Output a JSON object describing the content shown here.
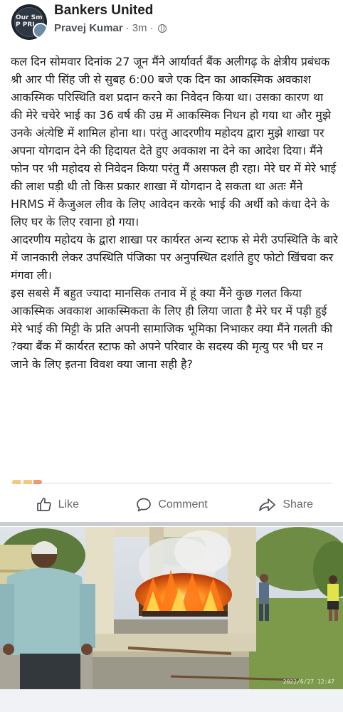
{
  "post": {
    "group_name": "Bankers United",
    "author": "Pravej Kumar",
    "time": "3m",
    "separator": "·",
    "privacy_icon": "globe-icon",
    "avatar_text": "Our Sm P PRI",
    "paragraphs": [
      "कल दिन सोमवार दिनांक 27 जून मैंने आर्यावर्त बैंक  अलीगढ़ के क्षेत्रीय प्रबंधक श्री आर पी सिंह जी से सुबह 6:00 बजे एक दिन का आकस्मिक अवकाश आकस्मिक परिस्थिति वश प्रदान करने का निवेदन किया था। उसका कारण था की मेरे चचेरे भाई का 36 वर्ष की उम्र में आकस्मिक निधन हो गया था और मुझे उनके अंत्येष्टि में शामिल होना था। परंतु आदरणीय महोदय द्वारा मुझे शाखा पर अपना योगदान देने की हिदायत देते हुए अवकाश ना देने का आदेश दिया। मैंने फोन पर भी महोदय से निवेदन किया परंतु मैं असफल ही रहा। मेरे घर में मेरे भाई की लाश पड़ी थी तो किस प्रकार शाखा में योगदान दे सकता था अतः मैंने HRMS में कैजुअल लीव के लिए आवेदन करके भाई की अर्थी को कंधा देने के लिए घर के लिए रवाना हो गया।",
      "आदरणीय महोदय के द्वारा शाखा पर कार्यरत अन्य स्टाफ से मेरी उपस्थिति के बारे में जानकारी लेकर उपस्थिति पंजिका पर अनुपस्थित दर्शाते हुए फोटो खिंचवा कर मंगवा ली।",
      "इस सबसे मैं बहुत ज्यादा मानसिक तनाव में हूं क्या मैंने कुछ गलत किया आकस्मिक अवकाश आकस्मिकता के लिए ही लिया जाता है मेरे घर में पड़ी हुई मेरे भाई की मिट्टी के प्रति अपनी सामाजिक भूमिका निभाकर क्या मैंने गलती की ?क्या बैंक में कार्यरत स्टाफ को अपने परिवार के सदस्य  की मृत्यु पर भी घर न जाने के लिए इतना विवश क्या जाना सही है?"
    ]
  },
  "actions": {
    "like": "Like",
    "comment": "Comment",
    "share": "Share"
  },
  "photo": {
    "timestamp": "2022/6/27 12:47"
  },
  "colors": {
    "text": "#1c1e21",
    "secondary": "#65676b",
    "divider": "#c9ccd1"
  }
}
